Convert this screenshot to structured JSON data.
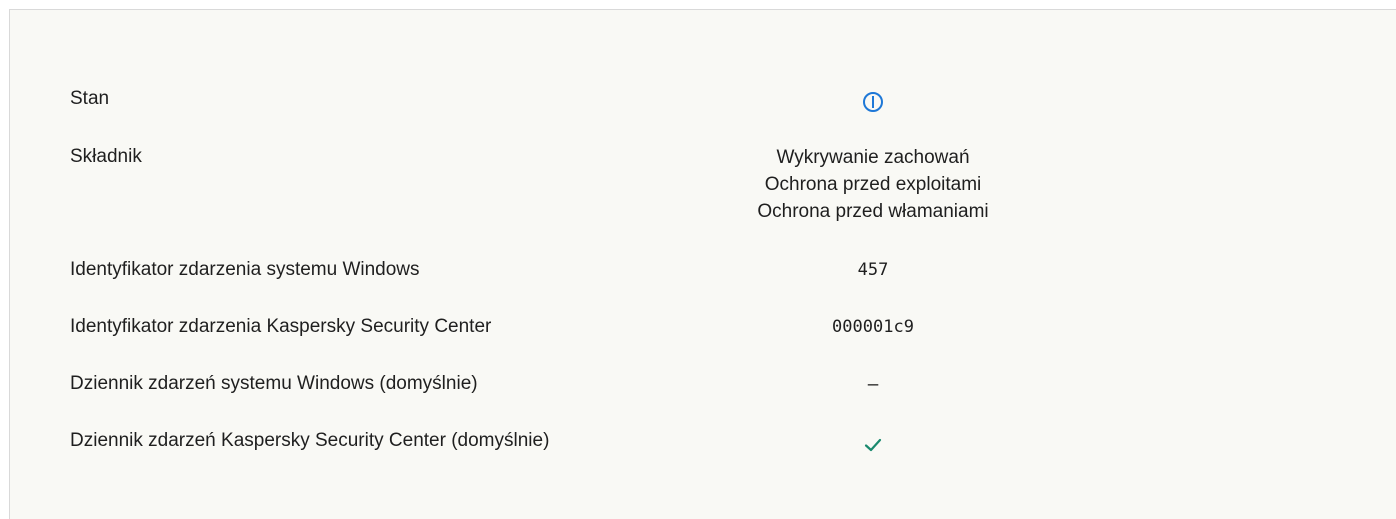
{
  "rows": {
    "status": {
      "label": "Stan",
      "icon": "info-icon",
      "icon_color": "#1e78d7"
    },
    "component": {
      "label": "Składnik",
      "values": [
        "Wykrywanie zachowań",
        "Ochrona przed exploitami",
        "Ochrona przed włamaniami"
      ]
    },
    "windows_event_id": {
      "label": "Identyfikator zdarzenia systemu Windows",
      "value": "457"
    },
    "ksc_event_id": {
      "label": "Identyfikator zdarzenia Kaspersky Security Center",
      "value": "000001c9"
    },
    "windows_log": {
      "label": "Dziennik zdarzeń systemu Windows (domyślnie)",
      "value": "–"
    },
    "ksc_log": {
      "label": "Dziennik zdarzeń Kaspersky Security Center (domyślnie)",
      "icon": "checkmark-icon",
      "icon_color": "#1a8a6e"
    }
  }
}
